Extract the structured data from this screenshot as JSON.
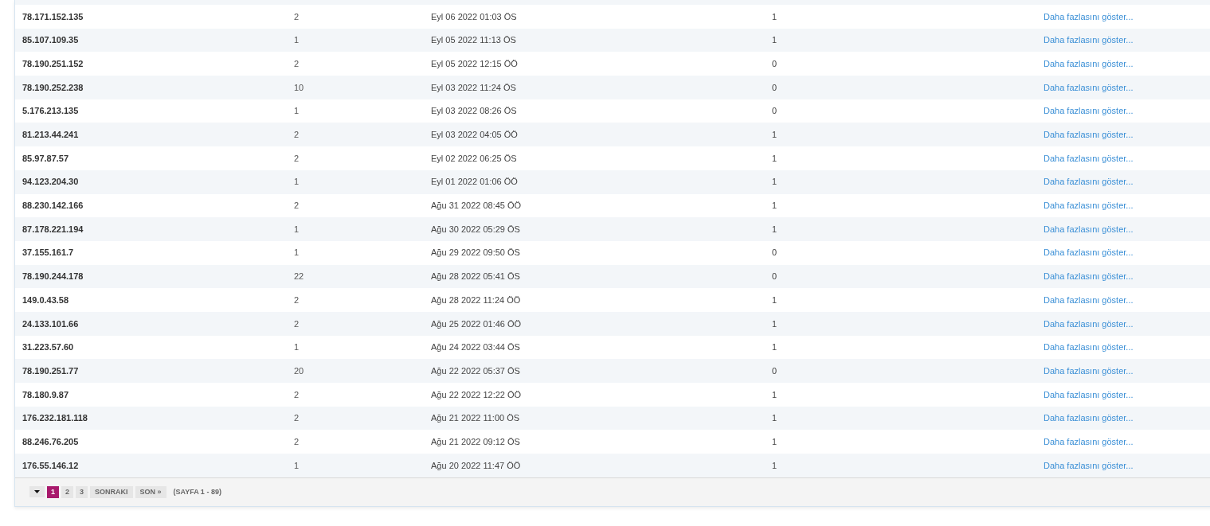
{
  "table": {
    "rows": [
      {
        "ip": "78.171.152.135",
        "count": "2",
        "date": "Eyl 06 2022 01:03 ÖS",
        "column_4": "1",
        "link": "Daha fazlasını göster..."
      },
      {
        "ip": "85.107.109.35",
        "count": "1",
        "date": "Eyl 05 2022 11:13 ÖS",
        "column_4": "1",
        "link": "Daha fazlasını göster..."
      },
      {
        "ip": "78.190.251.152",
        "count": "2",
        "date": "Eyl 05 2022 12:15 ÖÖ",
        "column_4": "0",
        "link": "Daha fazlasını göster..."
      },
      {
        "ip": "78.190.252.238",
        "count": "10",
        "date": "Eyl 03 2022 11:24 ÖS",
        "column_4": "0",
        "link": "Daha fazlasını göster..."
      },
      {
        "ip": "5.176.213.135",
        "count": "1",
        "date": "Eyl 03 2022 08:26 ÖS",
        "column_4": "0",
        "link": "Daha fazlasını göster..."
      },
      {
        "ip": "81.213.44.241",
        "count": "2",
        "date": "Eyl 03 2022 04:05 ÖÖ",
        "column_4": "1",
        "link": "Daha fazlasını göster..."
      },
      {
        "ip": "85.97.87.57",
        "count": "2",
        "date": "Eyl 02 2022 06:25 ÖS",
        "column_4": "1",
        "link": "Daha fazlasını göster..."
      },
      {
        "ip": "94.123.204.30",
        "count": "1",
        "date": "Eyl 01 2022 01:06 ÖÖ",
        "column_4": "1",
        "link": "Daha fazlasını göster..."
      },
      {
        "ip": "88.230.142.166",
        "count": "2",
        "date": "Ağu 31 2022 08:45 ÖÖ",
        "column_4": "1",
        "link": "Daha fazlasını göster..."
      },
      {
        "ip": "87.178.221.194",
        "count": "1",
        "date": "Ağu 30 2022 05:29 ÖS",
        "column_4": "1",
        "link": "Daha fazlasını göster..."
      },
      {
        "ip": "37.155.161.7",
        "count": "1",
        "date": "Ağu 29 2022 09:50 ÖS",
        "column_4": "0",
        "link": "Daha fazlasını göster..."
      },
      {
        "ip": "78.190.244.178",
        "count": "22",
        "date": "Ağu 28 2022 05:41 ÖS",
        "column_4": "0",
        "link": "Daha fazlasını göster..."
      },
      {
        "ip": "149.0.43.58",
        "count": "2",
        "date": "Ağu 28 2022 11:24 ÖÖ",
        "column_4": "1",
        "link": "Daha fazlasını göster..."
      },
      {
        "ip": "24.133.101.66",
        "count": "2",
        "date": "Ağu 25 2022 01:46 ÖÖ",
        "column_4": "1",
        "link": "Daha fazlasını göster..."
      },
      {
        "ip": "31.223.57.60",
        "count": "1",
        "date": "Ağu 24 2022 03:44 ÖS",
        "column_4": "1",
        "link": "Daha fazlasını göster..."
      },
      {
        "ip": "78.190.251.77",
        "count": "20",
        "date": "Ağu 22 2022 05:37 ÖS",
        "column_4": "0",
        "link": "Daha fazlasını göster..."
      },
      {
        "ip": "78.180.9.87",
        "count": "2",
        "date": "Ağu 22 2022 12:22 ÖÖ",
        "column_4": "1",
        "link": "Daha fazlasını göster..."
      },
      {
        "ip": "176.232.181.118",
        "count": "2",
        "date": "Ağu 21 2022 11:00 ÖS",
        "column_4": "1",
        "link": "Daha fazlasını göster..."
      },
      {
        "ip": "88.246.76.205",
        "count": "2",
        "date": "Ağu 21 2022 09:12 ÖS",
        "column_4": "1",
        "link": "Daha fazlasını göster..."
      },
      {
        "ip": "176.55.146.12",
        "count": "1",
        "date": "Ağu 20 2022 11:47 ÖÖ",
        "column_4": "1",
        "link": "Daha fazlasını göster..."
      }
    ]
  },
  "pagination": {
    "pages": [
      {
        "label": "1",
        "selected": true
      },
      {
        "label": "2",
        "selected": false
      },
      {
        "label": "3",
        "selected": false
      }
    ],
    "next": "SONRAKI",
    "last": "SON »",
    "info": "(SAYFA 1 - 89)"
  }
}
